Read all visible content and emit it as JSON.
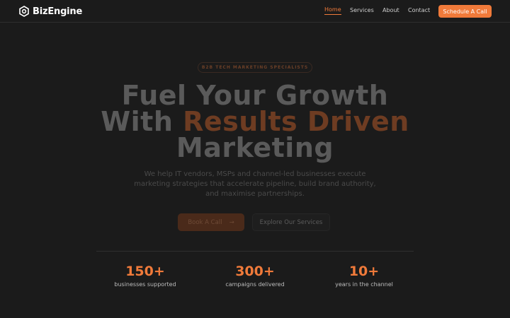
{
  "brand": {
    "name": "BizEngine",
    "icon": "hexagon-gear-icon",
    "accent": "#f07a3a"
  },
  "nav": {
    "items": [
      {
        "label": "Home",
        "active": true
      },
      {
        "label": "Services",
        "active": false
      },
      {
        "label": "About",
        "active": false
      },
      {
        "label": "Contact",
        "active": false
      }
    ],
    "cta_label": "Schedule A Call"
  },
  "hero": {
    "eyebrow": "B2B TECH MARKETING SPECIALISTS",
    "headline_line1": "Fuel Your Growth",
    "headline_line2_plain": "With",
    "headline_line2_accent": "Results Driven",
    "headline_line3": "Marketing",
    "subtext": "We help IT vendors, MSPs and channel-led businesses execute marketing strategies that accelerate pipeline, build brand authority, and maximise partnerships.",
    "primary_button": "Book A Call",
    "primary_button_icon": "arrow-right-icon",
    "secondary_button": "Explore Our Services"
  },
  "stats": [
    {
      "value": "150+",
      "label": "businesses supported"
    },
    {
      "value": "300+",
      "label": "campaigns delivered"
    },
    {
      "value": "10+",
      "label": "years in the channel"
    }
  ]
}
